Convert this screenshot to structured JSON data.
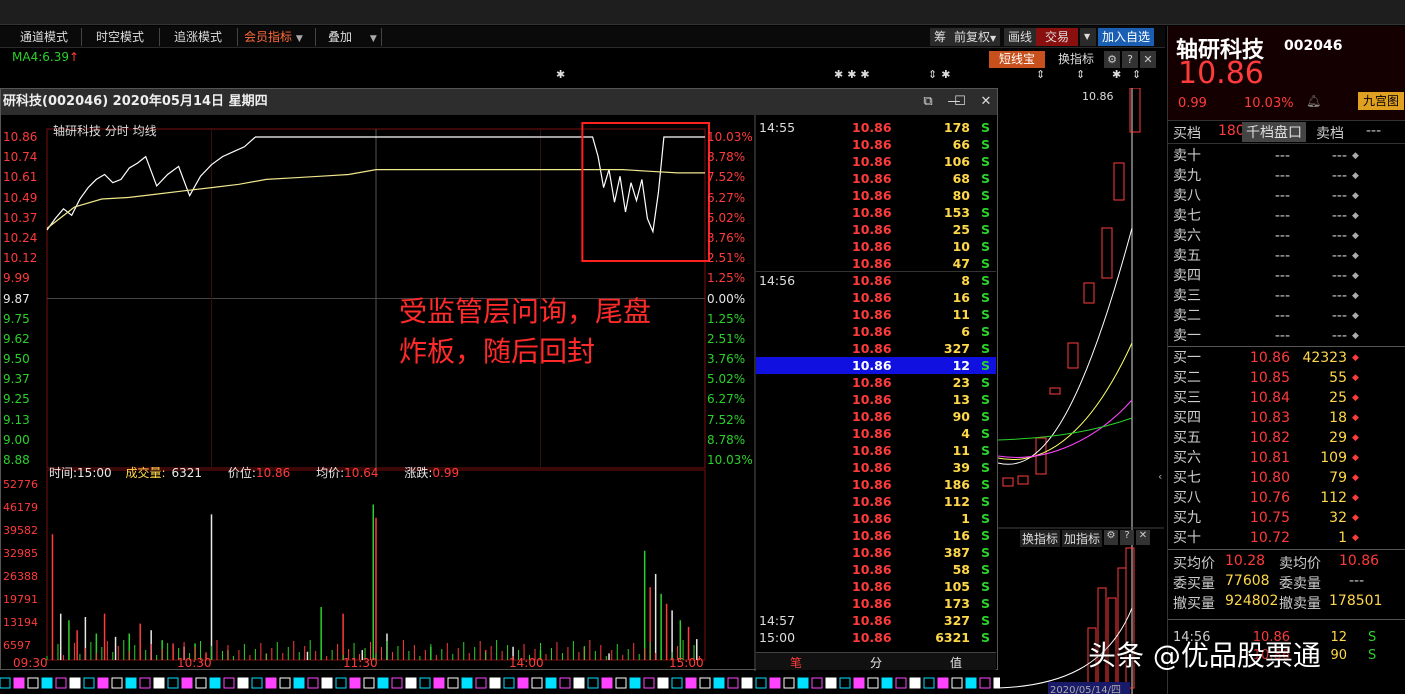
{
  "toolbar": {
    "tabs": [
      "通道模式",
      "时空模式",
      "追涨模式",
      "会员指标",
      "叠加"
    ],
    "right_buttons": [
      "筹",
      "前复权",
      "画线",
      "交易",
      "加入自选"
    ],
    "sub_buttons": [
      "短线宝",
      "换指标"
    ],
    "ma_label": "MA4:6.39"
  },
  "window": {
    "title": "研科技(002046)  2020年05月14日  星期四",
    "chart_header": "轴研科技 分时 均线"
  },
  "chart_data": {
    "type": "line",
    "title": "轴研科技 分时 均线",
    "y_ticks": [
      "10.86",
      "10.74",
      "10.61",
      "10.49",
      "10.37",
      "10.24",
      "10.12",
      "9.99",
      "9.87",
      "9.75",
      "9.62",
      "9.50",
      "9.37",
      "9.25",
      "9.13",
      "9.00",
      "8.88"
    ],
    "pct_ticks": [
      "10.03%",
      "8.78%",
      "7.52%",
      "6.27%",
      "5.02%",
      "3.76%",
      "2.51%",
      "1.25%",
      "0.00%",
      "1.25%",
      "2.51%",
      "3.76%",
      "5.02%",
      "6.27%",
      "7.52%",
      "8.78%",
      "10.03%"
    ],
    "ylim": [
      8.88,
      10.86
    ],
    "x_ticks": [
      "09:30",
      "10:30",
      "11:30",
      "14:00",
      "15:00"
    ],
    "series": [
      {
        "name": "分时",
        "color": "#ffffff",
        "x": [
          0,
          3,
          6,
          9,
          12,
          15,
          18,
          21,
          24,
          27,
          30,
          33,
          36,
          40,
          44,
          48,
          52,
          56,
          60,
          64,
          68,
          72,
          76,
          80,
          84,
          88,
          92,
          96,
          100,
          104,
          108,
          112,
          116,
          120,
          125,
          130,
          135,
          140,
          150,
          160,
          170,
          180,
          190,
          195,
          197,
          199,
          201,
          203,
          205,
          207,
          209,
          211,
          213,
          215,
          217,
          219,
          221,
          223,
          225,
          227,
          229,
          231,
          233,
          235,
          237,
          240
        ],
        "y": [
          10.29,
          10.36,
          10.42,
          10.38,
          10.48,
          10.55,
          10.6,
          10.63,
          10.58,
          10.6,
          10.67,
          10.7,
          10.74,
          10.56,
          10.63,
          10.68,
          10.5,
          10.62,
          10.69,
          10.74,
          10.77,
          10.8,
          10.86,
          10.86,
          10.86,
          10.86,
          10.86,
          10.86,
          10.86,
          10.86,
          10.86,
          10.86,
          10.86,
          10.86,
          10.86,
          10.86,
          10.86,
          10.86,
          10.86,
          10.86,
          10.86,
          10.86,
          10.86,
          10.86,
          10.86,
          10.86,
          10.74,
          10.55,
          10.66,
          10.46,
          10.62,
          10.4,
          10.58,
          10.47,
          10.6,
          10.36,
          10.28,
          10.52,
          10.86,
          10.86,
          10.86,
          10.86,
          10.86,
          10.86,
          10.86,
          10.86
        ]
      },
      {
        "name": "均线",
        "color": "#f0e68c",
        "x": [
          0,
          10,
          20,
          30,
          40,
          50,
          60,
          70,
          80,
          90,
          100,
          110,
          120,
          130,
          140,
          150,
          160,
          170,
          180,
          190,
          200,
          210,
          220,
          230,
          240
        ],
        "y": [
          10.3,
          10.43,
          10.48,
          10.49,
          10.51,
          10.53,
          10.55,
          10.57,
          10.6,
          10.61,
          10.62,
          10.63,
          10.66,
          10.66,
          10.66,
          10.66,
          10.66,
          10.66,
          10.66,
          10.66,
          10.66,
          10.66,
          10.65,
          10.64,
          10.64
        ]
      }
    ],
    "volume": {
      "y_ticks": [
        "52776",
        "46179",
        "39582",
        "32985",
        "26388",
        "19791",
        "13194",
        "6597"
      ],
      "bars": [
        {
          "x": 2,
          "v": 38000
        },
        {
          "x": 5,
          "v": 14000
        },
        {
          "x": 8,
          "v": 12000
        },
        {
          "x": 11,
          "v": 9000
        },
        {
          "x": 14,
          "v": 13000
        },
        {
          "x": 18,
          "v": 8000
        },
        {
          "x": 21,
          "v": 14000
        },
        {
          "x": 25,
          "v": 7000
        },
        {
          "x": 30,
          "v": 8000
        },
        {
          "x": 34,
          "v": 11000
        },
        {
          "x": 38,
          "v": 9000
        },
        {
          "x": 42,
          "v": 6000
        },
        {
          "x": 46,
          "v": 5000
        },
        {
          "x": 50,
          "v": 4000
        },
        {
          "x": 54,
          "v": 5000
        },
        {
          "x": 58,
          "v": 2000
        },
        {
          "x": 60,
          "v": 44000
        },
        {
          "x": 66,
          "v": 3000
        },
        {
          "x": 80,
          "v": 2000
        },
        {
          "x": 95,
          "v": 2500
        },
        {
          "x": 100,
          "v": 16000
        },
        {
          "x": 108,
          "v": 14000
        },
        {
          "x": 115,
          "v": 3000
        },
        {
          "x": 119,
          "v": 47000
        },
        {
          "x": 120,
          "v": 43000
        },
        {
          "x": 124,
          "v": 8000
        },
        {
          "x": 140,
          "v": 4000
        },
        {
          "x": 160,
          "v": 3000
        },
        {
          "x": 170,
          "v": 4000
        },
        {
          "x": 180,
          "v": 3000
        },
        {
          "x": 196,
          "v": 4000
        },
        {
          "x": 205,
          "v": 2000
        },
        {
          "x": 218,
          "v": 33000
        },
        {
          "x": 220,
          "v": 22000
        },
        {
          "x": 222,
          "v": 26000
        },
        {
          "x": 224,
          "v": 20000
        },
        {
          "x": 226,
          "v": 17000
        },
        {
          "x": 228,
          "v": 15000
        },
        {
          "x": 231,
          "v": 12000
        },
        {
          "x": 234,
          "v": 10000
        },
        {
          "x": 237,
          "v": 6321
        }
      ]
    },
    "stats": {
      "time": "15:00",
      "volume": "6321",
      "price": "10.86",
      "avg": "10.64",
      "change": "0.99"
    },
    "stats_labels": {
      "time": "时间:",
      "volume": "成交量:",
      "price": "价位:",
      "avg": "均价:",
      "change": "涨跌:"
    }
  },
  "annotation": {
    "line1": "受监管层问询，尾盘",
    "line2": "炸板，随后回封"
  },
  "ticks": {
    "rows": [
      {
        "t": "14:55",
        "p": "10.86",
        "v": "178",
        "s": "S"
      },
      {
        "t": "",
        "p": "10.86",
        "v": "66",
        "s": "S"
      },
      {
        "t": "",
        "p": "10.86",
        "v": "106",
        "s": "S"
      },
      {
        "t": "",
        "p": "10.86",
        "v": "68",
        "s": "S"
      },
      {
        "t": "",
        "p": "10.86",
        "v": "80",
        "s": "S"
      },
      {
        "t": "",
        "p": "10.86",
        "v": "153",
        "s": "S"
      },
      {
        "t": "",
        "p": "10.86",
        "v": "25",
        "s": "S"
      },
      {
        "t": "",
        "p": "10.86",
        "v": "10",
        "s": "S"
      },
      {
        "t": "",
        "p": "10.86",
        "v": "47",
        "s": "S"
      },
      {
        "t": "14:56",
        "p": "10.86",
        "v": "8",
        "s": "S"
      },
      {
        "t": "",
        "p": "10.86",
        "v": "16",
        "s": "S"
      },
      {
        "t": "",
        "p": "10.86",
        "v": "11",
        "s": "S"
      },
      {
        "t": "",
        "p": "10.86",
        "v": "6",
        "s": "S"
      },
      {
        "t": "",
        "p": "10.86",
        "v": "327",
        "s": "S"
      },
      {
        "t": "",
        "p": "10.86",
        "v": "12",
        "s": "S"
      },
      {
        "t": "",
        "p": "10.86",
        "v": "23",
        "s": "S"
      },
      {
        "t": "",
        "p": "10.86",
        "v": "13",
        "s": "S"
      },
      {
        "t": "",
        "p": "10.86",
        "v": "90",
        "s": "S"
      },
      {
        "t": "",
        "p": "10.86",
        "v": "4",
        "s": "S"
      },
      {
        "t": "",
        "p": "10.86",
        "v": "11",
        "s": "S"
      },
      {
        "t": "",
        "p": "10.86",
        "v": "39",
        "s": "S"
      },
      {
        "t": "",
        "p": "10.86",
        "v": "186",
        "s": "S"
      },
      {
        "t": "",
        "p": "10.86",
        "v": "112",
        "s": "S"
      },
      {
        "t": "",
        "p": "10.86",
        "v": "1",
        "s": "S"
      },
      {
        "t": "",
        "p": "10.86",
        "v": "16",
        "s": "S"
      },
      {
        "t": "",
        "p": "10.86",
        "v": "387",
        "s": "S"
      },
      {
        "t": "",
        "p": "10.86",
        "v": "58",
        "s": "S"
      },
      {
        "t": "",
        "p": "10.86",
        "v": "105",
        "s": "S"
      },
      {
        "t": "",
        "p": "10.86",
        "v": "173",
        "s": "S"
      },
      {
        "t": "14:57",
        "p": "10.86",
        "v": "327",
        "s": "S"
      },
      {
        "t": "15:00",
        "p": "10.86",
        "v": "6321",
        "s": "S"
      }
    ],
    "selected_index": 14,
    "footer": [
      "笔",
      "分",
      "值"
    ]
  },
  "kline": {
    "price_label": "10.86",
    "btn1": "换指标",
    "btn2": "加指标",
    "date_label": "2020/05/14/四"
  },
  "quote": {
    "name": "轴研科技",
    "code": "002046",
    "price": "10.86",
    "change": "0.99",
    "pct": "10.03%",
    "nine_grid": "九宫图",
    "sell_label": "买档",
    "sell_count": "180",
    "panel_title": "千档盘口",
    "sell_label2": "卖档",
    "sell_dash": "---",
    "asks": [
      {
        "l": "卖十",
        "p": "---",
        "q": "---"
      },
      {
        "l": "卖九",
        "p": "---",
        "q": "---"
      },
      {
        "l": "卖八",
        "p": "---",
        "q": "---"
      },
      {
        "l": "卖七",
        "p": "---",
        "q": "---"
      },
      {
        "l": "卖六",
        "p": "---",
        "q": "---"
      },
      {
        "l": "卖五",
        "p": "---",
        "q": "---"
      },
      {
        "l": "卖四",
        "p": "---",
        "q": "---"
      },
      {
        "l": "卖三",
        "p": "---",
        "q": "---"
      },
      {
        "l": "卖二",
        "p": "---",
        "q": "---"
      },
      {
        "l": "卖一",
        "p": "---",
        "q": "---"
      }
    ],
    "bids": [
      {
        "l": "买一",
        "p": "10.86",
        "q": "42323"
      },
      {
        "l": "买二",
        "p": "10.85",
        "q": "55"
      },
      {
        "l": "买三",
        "p": "10.84",
        "q": "25"
      },
      {
        "l": "买四",
        "p": "10.83",
        "q": "18"
      },
      {
        "l": "买五",
        "p": "10.82",
        "q": "29"
      },
      {
        "l": "买六",
        "p": "10.81",
        "q": "109"
      },
      {
        "l": "买七",
        "p": "10.80",
        "q": "79"
      },
      {
        "l": "买八",
        "p": "10.76",
        "q": "112"
      },
      {
        "l": "买九",
        "p": "10.75",
        "q": "32"
      },
      {
        "l": "买十",
        "p": "10.72",
        "q": "1"
      }
    ],
    "stats": {
      "buy_avg_label": "买均价",
      "buy_avg": "10.28",
      "sell_avg_label": "卖均价",
      "sell_avg": "10.86",
      "bid_vol_label": "委买量",
      "bid_vol": "77608",
      "ask_vol_label": "委卖量",
      "ask_vol": "---",
      "cancel_buy_label": "撤买量",
      "cancel_buy": "924802",
      "cancel_sell_label": "撤卖量",
      "cancel_sell": "178501"
    },
    "tail": [
      {
        "t": "14:56",
        "p": "10.86",
        "v": "12",
        "s": "S"
      },
      {
        "t": "",
        "p": "10.86",
        "v": "90",
        "s": "S"
      }
    ]
  },
  "watermark": "头条 @优品股票通"
}
